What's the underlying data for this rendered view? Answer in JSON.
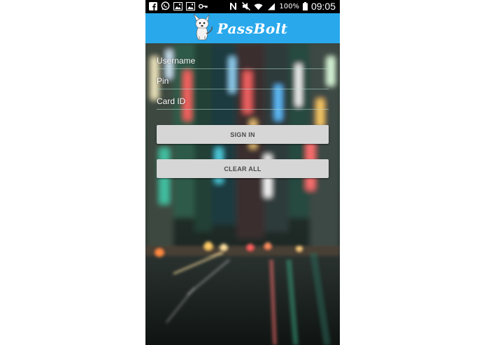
{
  "status_bar": {
    "icons": [
      "facebook-icon",
      "whatsapp-icon",
      "gallery-icon",
      "gallery-icon",
      "key-icon",
      "nfc-icon",
      "mute-icon",
      "wifi-icon",
      "signal-icon",
      "battery-icon"
    ],
    "battery": "100%",
    "time": "09:05"
  },
  "app_bar": {
    "title": "PassBolt",
    "logo": "dog-mascot-icon",
    "color": "#29a8ec"
  },
  "form": {
    "username_label": "Username",
    "pin_label": "Pin",
    "card_id_label": "Card ID"
  },
  "buttons": {
    "sign_in": "SIGN IN",
    "clear_all": "CLEAR ALL"
  }
}
